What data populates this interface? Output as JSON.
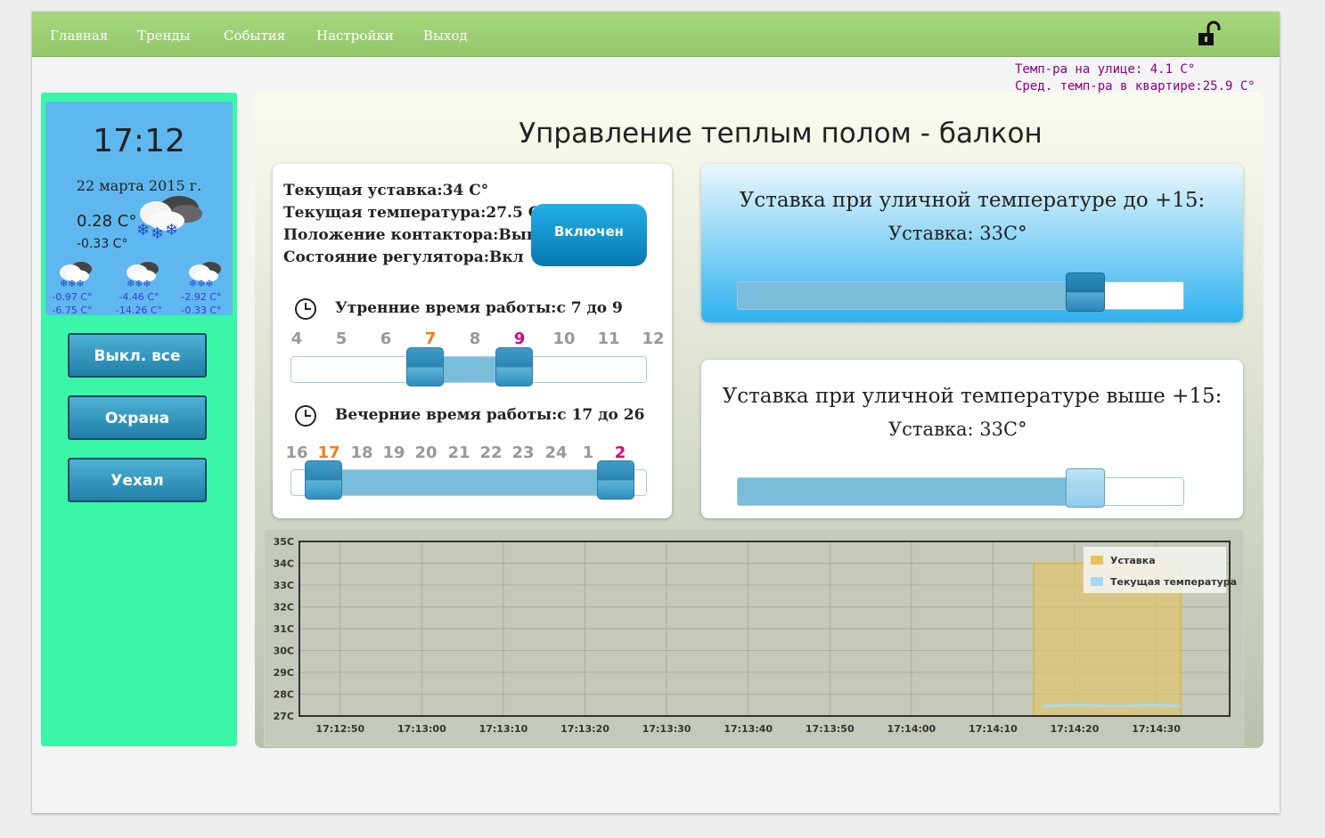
{
  "nav": {
    "items": [
      "Главная",
      "Тренды",
      "События",
      "Настройки",
      "Выход"
    ]
  },
  "outside": {
    "temp_out": "Темп-ра на улице: 4.1 С°",
    "temp_avg": "Сред. темп-ра в квартире:25.9 С°"
  },
  "weather": {
    "time": "17:12",
    "date": "22 марта 2015 г.",
    "current": "0.28 С°",
    "min": "-0.33 С°",
    "forecast": [
      {
        "hi": "-0.97 С°",
        "lo": "-6.75 С°",
        "icon": "snow-cloud-icon"
      },
      {
        "hi": "-4.46 С°",
        "lo": "-14.26 С°",
        "icon": "snow-cloud-icon"
      },
      {
        "hi": "-2.92 С°",
        "lo": "-0.33 С°",
        "icon": "snow-cloud-icon"
      }
    ]
  },
  "sidebar": {
    "buttons": [
      "Выкл. все",
      "Охрана",
      "Уехал"
    ]
  },
  "main": {
    "title": "Управление теплым полом - балкон",
    "status": {
      "setpoint": "Текущая уставка:34 С°",
      "temperature": "Текущая температура:27.5 С°",
      "contactor": "Положение контактора:Выкл",
      "regulator": "Состояние регулятора:Вкл",
      "toggle_label": "Включен"
    },
    "morning": {
      "label": "Утренние время работы:с 7 до 9",
      "ticks": [
        "4",
        "5",
        "6",
        "7",
        "8",
        "9",
        "10",
        "11",
        "12"
      ],
      "from": "7",
      "to": "9"
    },
    "evening": {
      "label": "Вечерние время работы:с 17 до 26",
      "ticks": [
        "16",
        "17",
        "18",
        "19",
        "20",
        "21",
        "22",
        "23",
        "24",
        "1",
        "2"
      ],
      "from": "17",
      "to": "2"
    },
    "setpoint_low": {
      "title": "Уставка при уличной температуре до +15:",
      "value": "Уставка: 33С°",
      "fraction": 0.76
    },
    "setpoint_high": {
      "title": "Уставка при уличной температуре выше +15:",
      "value": "Уставка: 33С°",
      "fraction": 0.76
    }
  },
  "colors": {
    "nav": "#9bcf72",
    "sidebar": "#3af7a8",
    "weather_panel": "#5eb8ef",
    "tick_from": "#f07d1a",
    "tick_to": "#e0007a",
    "outside_text": "#8b008b",
    "series_setpoint": "#e8c25a",
    "series_current": "#a8d8f0"
  },
  "chart_data": {
    "type": "area",
    "x": [
      "17:12:50",
      "17:13:00",
      "17:13:10",
      "17:13:20",
      "17:13:30",
      "17:13:40",
      "17:13:50",
      "17:14:00",
      "17:14:10",
      "17:14:20",
      "17:14:30"
    ],
    "ylim": [
      27,
      35
    ],
    "yticks": [
      "35C",
      "34C",
      "33C",
      "32C",
      "31C",
      "30C",
      "29C",
      "28C",
      "27C"
    ],
    "series": [
      {
        "name": "Уставка",
        "points": [
          [
            "17:14:15",
            34
          ],
          [
            "17:14:20",
            34
          ],
          [
            "17:14:25",
            34
          ],
          [
            "17:14:30",
            34
          ],
          [
            "17:14:33",
            34
          ]
        ]
      },
      {
        "name": "Текущая температура",
        "points": [
          [
            "17:14:16",
            27.45
          ],
          [
            "17:14:20",
            27.5
          ],
          [
            "17:14:25",
            27.45
          ],
          [
            "17:14:30",
            27.5
          ],
          [
            "17:14:33",
            27.45
          ]
        ]
      }
    ],
    "legend": "top-right",
    "grid": true
  }
}
